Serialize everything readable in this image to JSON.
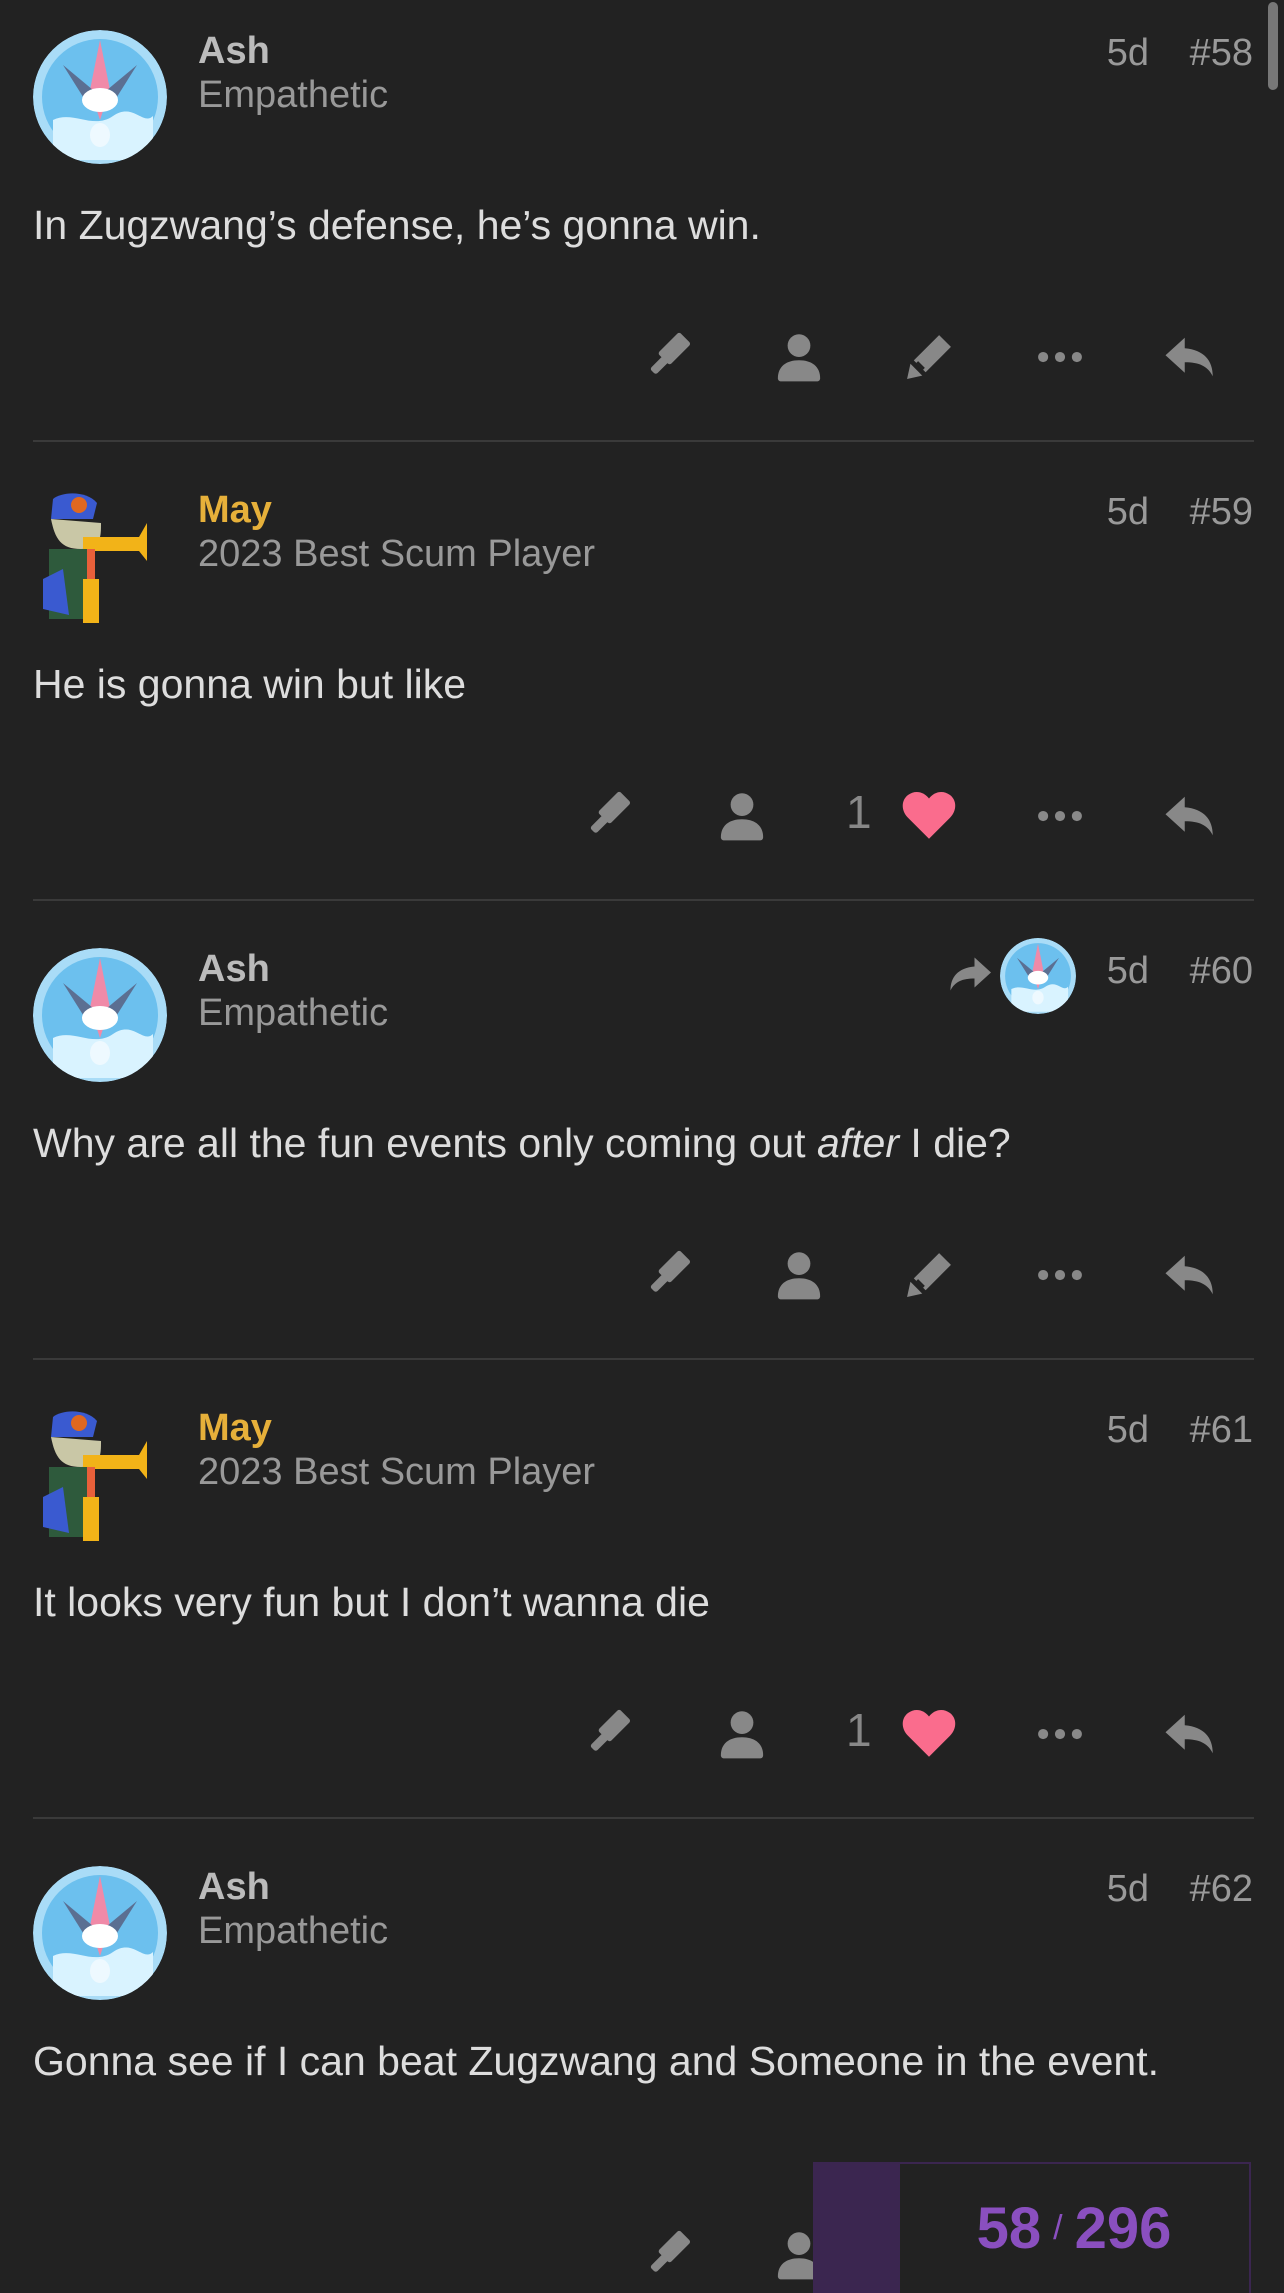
{
  "posts": [
    {
      "username": "Ash",
      "title": "Empathetic",
      "date": "5d",
      "number": "#58",
      "text": "In Zugzwang’s defense, he’s gonna win.",
      "likes": ""
    },
    {
      "username": "May",
      "title": "2023 Best Scum Player",
      "date": "5d",
      "number": "#59",
      "text": "He is gonna win but like",
      "likes": "1"
    },
    {
      "username": "Ash",
      "title": "Empathetic",
      "date": "5d",
      "number": "#60",
      "text_before": "Why are all the fun events only coming out ",
      "text_em": "after",
      "text_after": " I die?",
      "likes": ""
    },
    {
      "username": "May",
      "title": "2023 Best Scum Player",
      "date": "5d",
      "number": "#61",
      "text": "It looks very fun but I don’t wanna die",
      "likes": "1"
    },
    {
      "username": "Ash",
      "title": "Empathetic",
      "date": "5d",
      "number": "#62",
      "text": "Gonna see if I can beat Zugzwang and Someone in the event.",
      "likes": ""
    }
  ],
  "progress": {
    "current": "58",
    "total": "296",
    "separator": "/"
  },
  "colors": {
    "background": "#222222",
    "like": "#fa6c8d",
    "username_staff": "#e6b03a",
    "progress": "#8a4fbf"
  },
  "icons": [
    "gavel-icon",
    "user-icon",
    "pencil-icon",
    "ellipsis-icon",
    "reply-icon",
    "heart-icon",
    "share-arrow-icon"
  ]
}
